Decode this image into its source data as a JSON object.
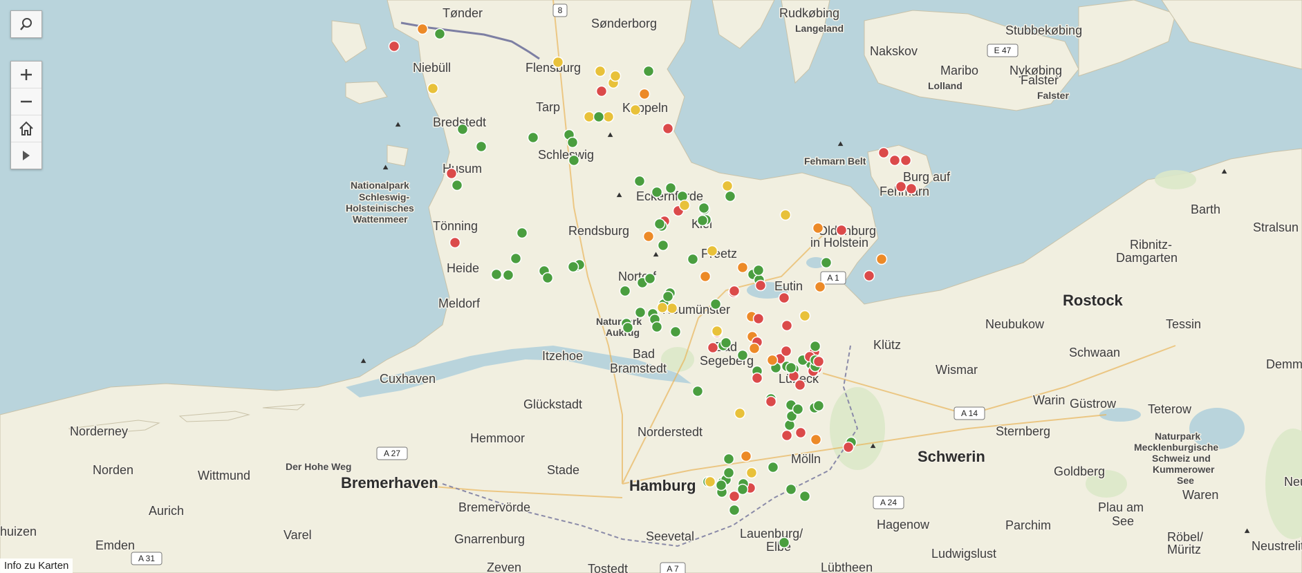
{
  "controls": {
    "search_icon": "search-icon",
    "zoom_in_icon": "plus-icon",
    "zoom_out_icon": "minus-icon",
    "home_icon": "home-icon",
    "play_icon": "play-icon"
  },
  "footer": {
    "info_link": "Info zu Karten"
  },
  "status_colors": {
    "green": "#4a9e3f",
    "yellow": "#e8c13a",
    "orange": "#ec8a28",
    "red": "#db4a4a"
  },
  "map_labels": [
    {
      "id": "tonder",
      "text": "Tønder",
      "cls": "city"
    },
    {
      "id": "sonderborg",
      "text": "Sønderborg",
      "cls": "city"
    },
    {
      "id": "rudkobing",
      "text": "Rudkøbing",
      "cls": "city"
    },
    {
      "id": "langeland",
      "text": "Langeland",
      "cls": "smallbold"
    },
    {
      "id": "stubbekobing",
      "text": "Stubbekøbing",
      "cls": "city"
    },
    {
      "id": "nakskov",
      "text": "Nakskov",
      "cls": "city"
    },
    {
      "id": "maribo",
      "text": "Maribo",
      "cls": "city"
    },
    {
      "id": "lolland",
      "text": "Lolland",
      "cls": "smallbold"
    },
    {
      "id": "nykobing",
      "text": "Nykøbing",
      "cls": "city"
    },
    {
      "id": "falster1",
      "text": "Falster",
      "cls": "city"
    },
    {
      "id": "falster2",
      "text": "Falster",
      "cls": "smallbold"
    },
    {
      "id": "niebull",
      "text": "Niebüll",
      "cls": "city"
    },
    {
      "id": "flensburg",
      "text": "Flensburg",
      "cls": "city"
    },
    {
      "id": "tarp",
      "text": "Tarp",
      "cls": "city"
    },
    {
      "id": "kappeln",
      "text": "Kappeln",
      "cls": "city"
    },
    {
      "id": "bredstedt",
      "text": "Bredstedt",
      "cls": "city"
    },
    {
      "id": "husum",
      "text": "Husum",
      "cls": "city"
    },
    {
      "id": "schleswig",
      "text": "Schleswig",
      "cls": "city"
    },
    {
      "id": "fehmarnbelt",
      "text": "Fehmarn Belt",
      "cls": "smallbold"
    },
    {
      "id": "burg1",
      "text": "Burg auf",
      "cls": "city"
    },
    {
      "id": "burg2",
      "text": "Fehmarn",
      "cls": "city"
    },
    {
      "id": "np1",
      "text": "Nationalpark",
      "cls": "smallbold"
    },
    {
      "id": "np2",
      "text": "Schleswig-",
      "cls": "smallbold"
    },
    {
      "id": "np3",
      "text": "Holsteinisches",
      "cls": "smallbold"
    },
    {
      "id": "np4",
      "text": "Wattenmeer",
      "cls": "smallbold"
    },
    {
      "id": "eckernforde",
      "text": "Eckernförde",
      "cls": "city"
    },
    {
      "id": "kiel",
      "text": "Kiel",
      "cls": "city"
    },
    {
      "id": "tonning",
      "text": "Tönning",
      "cls": "city"
    },
    {
      "id": "rendsburg",
      "text": "Rendsburg",
      "cls": "city"
    },
    {
      "id": "oldenburg1",
      "text": "Oldenburg",
      "cls": "city"
    },
    {
      "id": "oldenburg2",
      "text": "in Holstein",
      "cls": "city"
    },
    {
      "id": "barth",
      "text": "Barth",
      "cls": "city"
    },
    {
      "id": "stralsund",
      "text": "Stralsun",
      "cls": "city"
    },
    {
      "id": "ribnitz1",
      "text": "Ribnitz-",
      "cls": "city"
    },
    {
      "id": "ribnitz2",
      "text": "Damgarten",
      "cls": "city"
    },
    {
      "id": "preetz",
      "text": "Preetz",
      "cls": "city"
    },
    {
      "id": "heide",
      "text": "Heide",
      "cls": "city"
    },
    {
      "id": "nortorf",
      "text": "Nortorf",
      "cls": "city"
    },
    {
      "id": "eutin",
      "text": "Eutin",
      "cls": "city"
    },
    {
      "id": "rostock",
      "text": "Rostock",
      "cls": "bigcity"
    },
    {
      "id": "meldorf",
      "text": "Meldorf",
      "cls": "city"
    },
    {
      "id": "neumunster",
      "text": "Neumünster",
      "cls": "city"
    },
    {
      "id": "neubukow",
      "text": "Neubukow",
      "cls": "city"
    },
    {
      "id": "tessin",
      "text": "Tessin",
      "cls": "city"
    },
    {
      "id": "aukrug1",
      "text": "Naturpark",
      "cls": "smallbold"
    },
    {
      "id": "aukrug2",
      "text": "Aukrug",
      "cls": "smallbold"
    },
    {
      "id": "klutz",
      "text": "Klütz",
      "cls": "city"
    },
    {
      "id": "badseg1",
      "text": "Bad",
      "cls": "city"
    },
    {
      "id": "badseg2",
      "text": "Segeberg",
      "cls": "city"
    },
    {
      "id": "badbram1",
      "text": "Bad",
      "cls": "city"
    },
    {
      "id": "badbram2",
      "text": "Bramstedt",
      "cls": "city"
    },
    {
      "id": "wismar",
      "text": "Wismar",
      "cls": "city"
    },
    {
      "id": "schwaan",
      "text": "Schwaan",
      "cls": "city"
    },
    {
      "id": "demmin",
      "text": "Demmin",
      "cls": "city"
    },
    {
      "id": "cuxhaven",
      "text": "Cuxhaven",
      "cls": "city"
    },
    {
      "id": "itzehoe",
      "text": "Itzehoe",
      "cls": "city"
    },
    {
      "id": "lubeck",
      "text": "Lübeck",
      "cls": "city"
    },
    {
      "id": "warin",
      "text": "Warin",
      "cls": "city"
    },
    {
      "id": "gustrow",
      "text": "Güstrow",
      "cls": "city"
    },
    {
      "id": "teterow",
      "text": "Teterow",
      "cls": "city"
    },
    {
      "id": "gluckstadt",
      "text": "Glückstadt",
      "cls": "city"
    },
    {
      "id": "norderney",
      "text": "Norderney",
      "cls": "city"
    },
    {
      "id": "hemmoor",
      "text": "Hemmoor",
      "cls": "city"
    },
    {
      "id": "norderstedt",
      "text": "Norderstedt",
      "cls": "city"
    },
    {
      "id": "sternberg",
      "text": "Sternberg",
      "cls": "city"
    },
    {
      "id": "npmeck1",
      "text": "Naturpark",
      "cls": "smallbold"
    },
    {
      "id": "npmeck2",
      "text": "Mecklenburgische",
      "cls": "smallbold"
    },
    {
      "id": "npmeck3",
      "text": "Schweiz und",
      "cls": "smallbold"
    },
    {
      "id": "npmeck4",
      "text": "Kummerower",
      "cls": "smallbold"
    },
    {
      "id": "npmeck5",
      "text": "See",
      "cls": "smallbold"
    },
    {
      "id": "norden",
      "text": "Norden",
      "cls": "city"
    },
    {
      "id": "wittmund",
      "text": "Wittmund",
      "cls": "city"
    },
    {
      "id": "hoheweg",
      "text": "Der Hohe Weg",
      "cls": "smallbold"
    },
    {
      "id": "bremerhaven",
      "text": "Bremerhaven",
      "cls": "bigcity"
    },
    {
      "id": "stade",
      "text": "Stade",
      "cls": "city"
    },
    {
      "id": "hamburg",
      "text": "Hamburg",
      "cls": "bigcity"
    },
    {
      "id": "molln",
      "text": "Mölln",
      "cls": "city"
    },
    {
      "id": "schwerin",
      "text": "Schwerin",
      "cls": "bigcity"
    },
    {
      "id": "goldberg",
      "text": "Goldberg",
      "cls": "city"
    },
    {
      "id": "waren",
      "text": "Waren",
      "cls": "city"
    },
    {
      "id": "neubrandenburg",
      "text": "Neubra",
      "cls": "city"
    },
    {
      "id": "aurich",
      "text": "Aurich",
      "cls": "city"
    },
    {
      "id": "bremervorde",
      "text": "Bremervörde",
      "cls": "city"
    },
    {
      "id": "plau1",
      "text": "Plau am",
      "cls": "city"
    },
    {
      "id": "plau2",
      "text": "See",
      "cls": "city"
    },
    {
      "id": "huizen",
      "text": "huizen",
      "cls": "city"
    },
    {
      "id": "varel",
      "text": "Varel",
      "cls": "city"
    },
    {
      "id": "hagenow",
      "text": "Hagenow",
      "cls": "city"
    },
    {
      "id": "parchim",
      "text": "Parchim",
      "cls": "city"
    },
    {
      "id": "emden",
      "text": "Emden",
      "cls": "city"
    },
    {
      "id": "gnarrenburg",
      "text": "Gnarrenburg",
      "cls": "city"
    },
    {
      "id": "seevetal",
      "text": "Seevetal",
      "cls": "city"
    },
    {
      "id": "lauenburg1",
      "text": "Lauenburg/",
      "cls": "city"
    },
    {
      "id": "lauenburg2",
      "text": "Elbe",
      "cls": "city"
    },
    {
      "id": "robel1",
      "text": "Röbel/",
      "cls": "city"
    },
    {
      "id": "robel2",
      "text": "Müritz",
      "cls": "city"
    },
    {
      "id": "neustrelitz",
      "text": "Neustrelit",
      "cls": "city"
    },
    {
      "id": "ludwigslust",
      "text": "Ludwigslust",
      "cls": "city"
    },
    {
      "id": "zeven",
      "text": "Zeven",
      "cls": "city"
    },
    {
      "id": "tostedt",
      "text": "Tostedt",
      "cls": "city"
    },
    {
      "id": "lubtheen",
      "text": "Lübtheen",
      "cls": "city"
    }
  ],
  "road_shields": [
    {
      "id": "r8",
      "text": "8"
    },
    {
      "id": "e47",
      "text": "E 47"
    },
    {
      "id": "a14",
      "text": "A 14"
    },
    {
      "id": "a27",
      "text": "A 27"
    },
    {
      "id": "a24",
      "text": "A 24"
    },
    {
      "id": "a31",
      "text": "A 31"
    },
    {
      "id": "a7",
      "text": "A 7"
    },
    {
      "id": "a1",
      "text": "A 1"
    }
  ],
  "markers": [
    {
      "s": "orange"
    },
    {
      "s": "green"
    },
    {
      "s": "red"
    },
    {
      "s": "yellow"
    },
    {
      "s": "yellow"
    },
    {
      "s": "yellow"
    },
    {
      "s": "yellow"
    },
    {
      "s": "yellow"
    },
    {
      "s": "red"
    },
    {
      "s": "green"
    },
    {
      "s": "orange"
    },
    {
      "s": "yellow"
    },
    {
      "s": "yellow"
    },
    {
      "s": "green"
    },
    {
      "s": "yellow"
    },
    {
      "s": "red"
    },
    {
      "s": "green"
    },
    {
      "s": "green"
    },
    {
      "s": "green"
    },
    {
      "s": "green"
    },
    {
      "s": "green"
    },
    {
      "s": "green"
    },
    {
      "s": "red"
    },
    {
      "s": "green"
    },
    {
      "s": "red"
    },
    {
      "s": "red"
    },
    {
      "s": "red"
    },
    {
      "s": "red"
    },
    {
      "s": "red"
    },
    {
      "s": "green"
    },
    {
      "s": "green"
    },
    {
      "s": "green"
    },
    {
      "s": "green"
    },
    {
      "s": "yellow"
    },
    {
      "s": "green"
    },
    {
      "s": "red"
    },
    {
      "s": "yellow"
    },
    {
      "s": "green"
    },
    {
      "s": "green"
    },
    {
      "s": "red"
    },
    {
      "s": "green"
    },
    {
      "s": "green"
    },
    {
      "s": "green"
    },
    {
      "s": "yellow"
    },
    {
      "s": "orange"
    },
    {
      "s": "red"
    },
    {
      "s": "red"
    },
    {
      "s": "green"
    },
    {
      "s": "orange"
    },
    {
      "s": "green"
    },
    {
      "s": "green"
    },
    {
      "s": "green"
    },
    {
      "s": "green"
    },
    {
      "s": "green"
    },
    {
      "s": "green"
    },
    {
      "s": "green"
    },
    {
      "s": "green"
    },
    {
      "s": "green"
    },
    {
      "s": "yellow"
    },
    {
      "s": "orange"
    },
    {
      "s": "green"
    },
    {
      "s": "green"
    },
    {
      "s": "orange"
    },
    {
      "s": "green"
    },
    {
      "s": "red"
    },
    {
      "s": "orange"
    },
    {
      "s": "red"
    },
    {
      "s": "green"
    },
    {
      "s": "green"
    },
    {
      "s": "green"
    },
    {
      "s": "green"
    },
    {
      "s": "green"
    },
    {
      "s": "green"
    },
    {
      "s": "green"
    },
    {
      "s": "red"
    },
    {
      "s": "red"
    },
    {
      "s": "red"
    },
    {
      "s": "orange"
    },
    {
      "s": "green"
    },
    {
      "s": "green"
    },
    {
      "s": "green"
    },
    {
      "s": "yellow"
    },
    {
      "s": "green"
    },
    {
      "s": "orange"
    },
    {
      "s": "green"
    },
    {
      "s": "green"
    },
    {
      "s": "green"
    },
    {
      "s": "green"
    },
    {
      "s": "green"
    },
    {
      "s": "green"
    },
    {
      "s": "green"
    },
    {
      "s": "yellow"
    },
    {
      "s": "red"
    },
    {
      "s": "orange"
    },
    {
      "s": "yellow"
    },
    {
      "s": "red"
    },
    {
      "s": "red"
    },
    {
      "s": "red"
    },
    {
      "s": "red"
    },
    {
      "s": "yellow"
    },
    {
      "s": "red"
    },
    {
      "s": "green"
    },
    {
      "s": "green"
    },
    {
      "s": "red"
    },
    {
      "s": "green"
    },
    {
      "s": "green"
    },
    {
      "s": "red"
    },
    {
      "s": "red"
    },
    {
      "s": "red"
    },
    {
      "s": "red"
    },
    {
      "s": "green"
    },
    {
      "s": "green"
    },
    {
      "s": "orange"
    },
    {
      "s": "red"
    },
    {
      "s": "red"
    },
    {
      "s": "green"
    },
    {
      "s": "green"
    },
    {
      "s": "red"
    },
    {
      "s": "green"
    },
    {
      "s": "orange"
    },
    {
      "s": "red"
    },
    {
      "s": "green"
    },
    {
      "s": "green"
    },
    {
      "s": "green"
    },
    {
      "s": "red"
    },
    {
      "s": "orange"
    },
    {
      "s": "red"
    },
    {
      "s": "red"
    },
    {
      "s": "yellow"
    },
    {
      "s": "green"
    },
    {
      "s": "green"
    },
    {
      "s": "green"
    },
    {
      "s": "green"
    },
    {
      "s": "green"
    },
    {
      "s": "green"
    },
    {
      "s": "green"
    },
    {
      "s": "green"
    },
    {
      "s": "green"
    },
    {
      "s": "green"
    },
    {
      "s": "red"
    },
    {
      "s": "orange"
    },
    {
      "s": "yellow"
    },
    {
      "s": "red"
    },
    {
      "s": "red"
    },
    {
      "s": "green"
    },
    {
      "s": "green"
    },
    {
      "s": "green"
    },
    {
      "s": "green"
    },
    {
      "s": "green"
    },
    {
      "s": "green"
    },
    {
      "s": "yellow"
    },
    {
      "s": "green"
    },
    {
      "s": "green"
    },
    {
      "s": "green"
    },
    {
      "s": "green"
    },
    {
      "s": "green"
    },
    {
      "s": "green"
    },
    {
      "s": "green"
    },
    {
      "s": "green"
    },
    {
      "s": "green"
    }
  ]
}
